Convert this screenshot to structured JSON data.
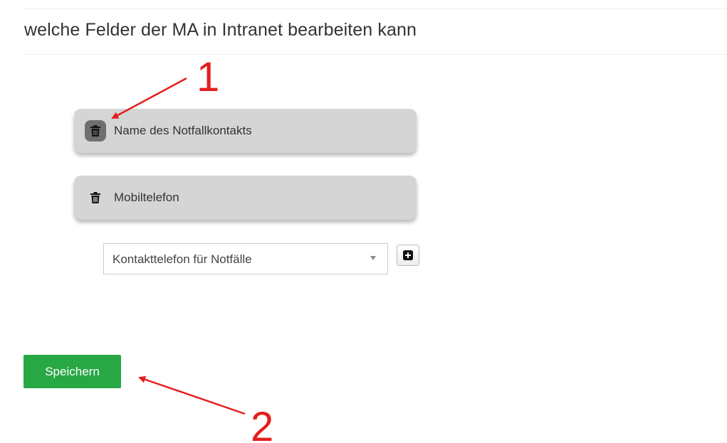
{
  "section": {
    "title": "welche Felder der MA in Intranet bearbeiten kann"
  },
  "fields": {
    "items": [
      {
        "label": "Name des Notfallkontakts",
        "icon": "trash-icon",
        "hovered": true
      },
      {
        "label": "Mobiltelefon",
        "icon": "trash-icon",
        "hovered": false
      }
    ]
  },
  "add_field": {
    "select_value": "Kontakttelefon für Notfälle",
    "add_icon": "plus-square-icon"
  },
  "actions": {
    "save_label": "Speichern"
  },
  "annotations": {
    "label_1": "1",
    "label_2": "2",
    "color": "#e41e1e"
  },
  "colors": {
    "save_button": "#28a745",
    "field_background": "#d5d5d5",
    "trash_hover": "#6f6f6f"
  }
}
